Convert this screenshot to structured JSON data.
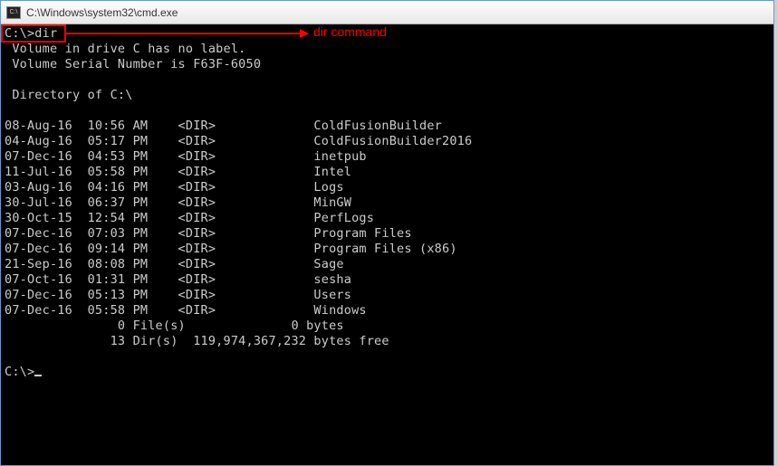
{
  "titlebar": {
    "icon_glyph": "C:\\",
    "title": "C:\\Windows\\system32\\cmd.exe"
  },
  "annotation": {
    "label": "dir command"
  },
  "prompt1": "C:\\>dir",
  "volume_line": " Volume in drive C has no label.",
  "serial_line": " Volume Serial Number is F63F-6050",
  "dir_of_line": " Directory of C:\\",
  "entries": [
    {
      "date": "08-Aug-16",
      "time": "10:56 AM",
      "type": "<DIR>",
      "name": "ColdFusionBuilder"
    },
    {
      "date": "04-Aug-16",
      "time": "05:17 PM",
      "type": "<DIR>",
      "name": "ColdFusionBuilder2016"
    },
    {
      "date": "07-Dec-16",
      "time": "04:53 PM",
      "type": "<DIR>",
      "name": "inetpub"
    },
    {
      "date": "11-Jul-16",
      "time": "05:58 PM",
      "type": "<DIR>",
      "name": "Intel"
    },
    {
      "date": "03-Aug-16",
      "time": "04:16 PM",
      "type": "<DIR>",
      "name": "Logs"
    },
    {
      "date": "30-Jul-16",
      "time": "06:37 PM",
      "type": "<DIR>",
      "name": "MinGW"
    },
    {
      "date": "30-Oct-15",
      "time": "12:54 PM",
      "type": "<DIR>",
      "name": "PerfLogs"
    },
    {
      "date": "07-Dec-16",
      "time": "07:03 PM",
      "type": "<DIR>",
      "name": "Program Files"
    },
    {
      "date": "07-Dec-16",
      "time": "09:14 PM",
      "type": "<DIR>",
      "name": "Program Files (x86)"
    },
    {
      "date": "21-Sep-16",
      "time": "08:08 PM",
      "type": "<DIR>",
      "name": "Sage"
    },
    {
      "date": "07-Oct-16",
      "time": "01:31 PM",
      "type": "<DIR>",
      "name": "sesha"
    },
    {
      "date": "07-Dec-16",
      "time": "05:13 PM",
      "type": "<DIR>",
      "name": "Users"
    },
    {
      "date": "07-Dec-16",
      "time": "05:58 PM",
      "type": "<DIR>",
      "name": "Windows"
    }
  ],
  "summary": {
    "files_line": "               0 File(s)              0 bytes",
    "dirs_line": "              13 Dir(s)  119,974,367,232 bytes free"
  },
  "prompt2": "C:\\>"
}
